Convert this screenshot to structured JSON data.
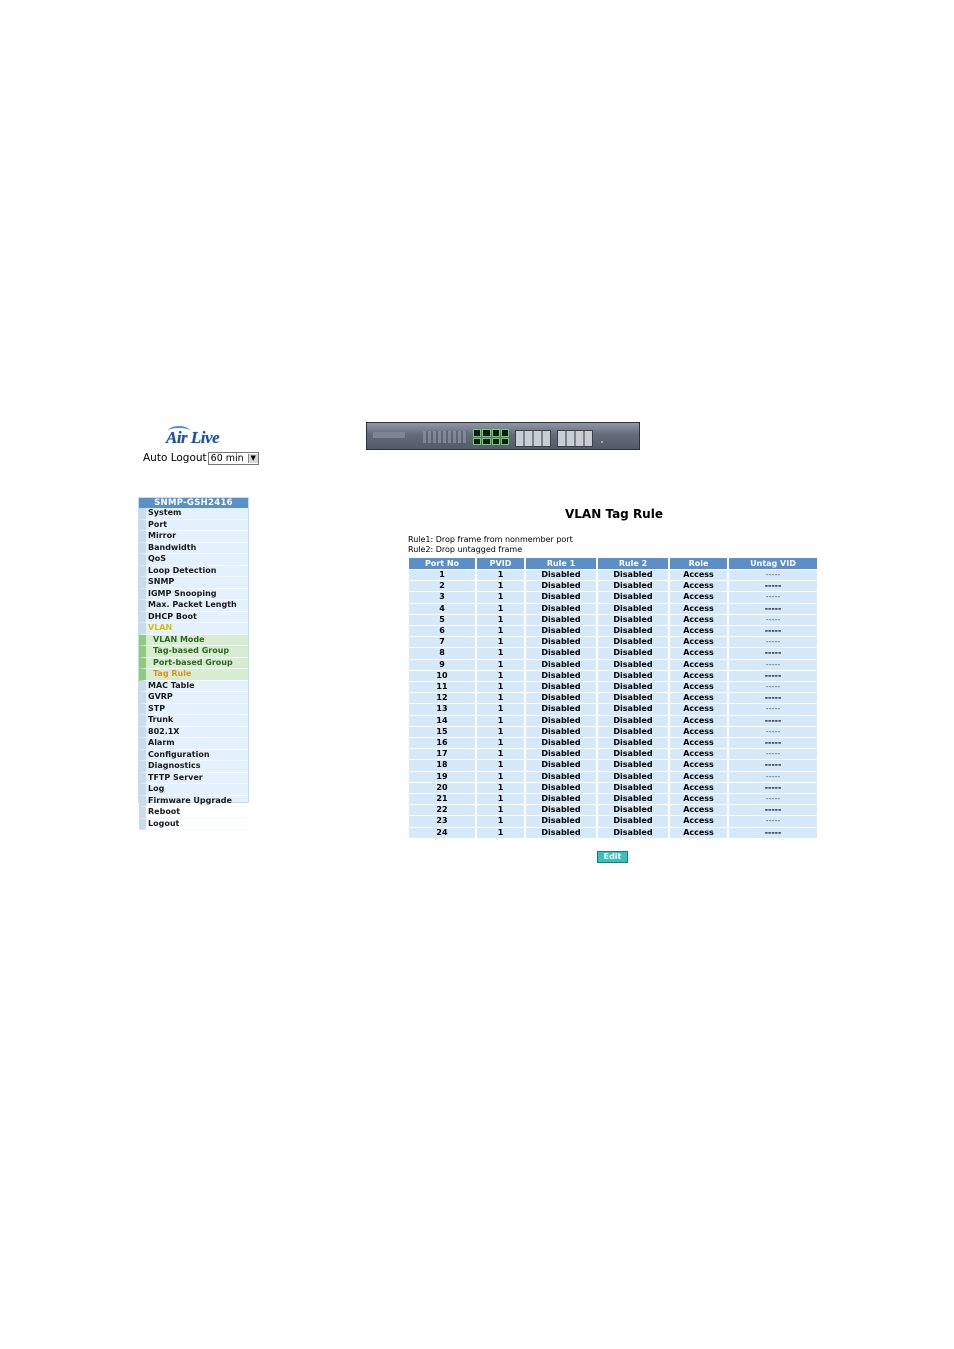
{
  "logo": {
    "text": "Air Live"
  },
  "auto_logout": {
    "label": "Auto Logout",
    "value": "60 min"
  },
  "menu": {
    "header": "SNMP-GSH2416",
    "items": [
      {
        "label": "System",
        "type": "item"
      },
      {
        "label": "Port",
        "type": "item"
      },
      {
        "label": "Mirror",
        "type": "item"
      },
      {
        "label": "Bandwidth",
        "type": "item"
      },
      {
        "label": "QoS",
        "type": "item"
      },
      {
        "label": "Loop Detection",
        "type": "item"
      },
      {
        "label": "SNMP",
        "type": "item"
      },
      {
        "label": "IGMP Snooping",
        "type": "item"
      },
      {
        "label": "Max. Packet Length",
        "type": "item"
      },
      {
        "label": "DHCP Boot",
        "type": "item"
      },
      {
        "label": "VLAN",
        "type": "vlan"
      },
      {
        "label": "VLAN Mode",
        "type": "sub"
      },
      {
        "label": "Tag-based Group",
        "type": "sub"
      },
      {
        "label": "Port-based Group",
        "type": "sub"
      },
      {
        "label": "Tag Rule",
        "type": "sub active"
      },
      {
        "label": "MAC Table",
        "type": "item"
      },
      {
        "label": "GVRP",
        "type": "item"
      },
      {
        "label": "STP",
        "type": "item"
      },
      {
        "label": "Trunk",
        "type": "item"
      },
      {
        "label": "802.1X",
        "type": "item"
      },
      {
        "label": "Alarm",
        "type": "item"
      },
      {
        "label": "Configuration",
        "type": "item"
      },
      {
        "label": "Diagnostics",
        "type": "item"
      },
      {
        "label": "TFTP Server",
        "type": "item"
      },
      {
        "label": "Log",
        "type": "item"
      },
      {
        "label": "Firmware Upgrade",
        "type": "item"
      },
      {
        "label": "Reboot",
        "type": "item"
      },
      {
        "label": "Logout",
        "type": "item"
      }
    ]
  },
  "page": {
    "title": "VLAN Tag Rule",
    "rule1": "Rule1: Drop frame from nonmember port",
    "rule2": "Rule2: Drop untagged frame"
  },
  "table": {
    "headers": [
      "Port No",
      "PVID",
      "Rule 1",
      "Rule 2",
      "Role",
      "Untag VID"
    ],
    "rows": [
      [
        "1",
        "1",
        "Disabled",
        "Disabled",
        "Access",
        "-----"
      ],
      [
        "2",
        "1",
        "Disabled",
        "Disabled",
        "Access",
        "-----"
      ],
      [
        "3",
        "1",
        "Disabled",
        "Disabled",
        "Access",
        "-----"
      ],
      [
        "4",
        "1",
        "Disabled",
        "Disabled",
        "Access",
        "-----"
      ],
      [
        "5",
        "1",
        "Disabled",
        "Disabled",
        "Access",
        "-----"
      ],
      [
        "6",
        "1",
        "Disabled",
        "Disabled",
        "Access",
        "-----"
      ],
      [
        "7",
        "1",
        "Disabled",
        "Disabled",
        "Access",
        "-----"
      ],
      [
        "8",
        "1",
        "Disabled",
        "Disabled",
        "Access",
        "-----"
      ],
      [
        "9",
        "1",
        "Disabled",
        "Disabled",
        "Access",
        "-----"
      ],
      [
        "10",
        "1",
        "Disabled",
        "Disabled",
        "Access",
        "-----"
      ],
      [
        "11",
        "1",
        "Disabled",
        "Disabled",
        "Access",
        "-----"
      ],
      [
        "12",
        "1",
        "Disabled",
        "Disabled",
        "Access",
        "-----"
      ],
      [
        "13",
        "1",
        "Disabled",
        "Disabled",
        "Access",
        "-----"
      ],
      [
        "14",
        "1",
        "Disabled",
        "Disabled",
        "Access",
        "-----"
      ],
      [
        "15",
        "1",
        "Disabled",
        "Disabled",
        "Access",
        "-----"
      ],
      [
        "16",
        "1",
        "Disabled",
        "Disabled",
        "Access",
        "-----"
      ],
      [
        "17",
        "1",
        "Disabled",
        "Disabled",
        "Access",
        "-----"
      ],
      [
        "18",
        "1",
        "Disabled",
        "Disabled",
        "Access",
        "-----"
      ],
      [
        "19",
        "1",
        "Disabled",
        "Disabled",
        "Access",
        "-----"
      ],
      [
        "20",
        "1",
        "Disabled",
        "Disabled",
        "Access",
        "-----"
      ],
      [
        "21",
        "1",
        "Disabled",
        "Disabled",
        "Access",
        "-----"
      ],
      [
        "22",
        "1",
        "Disabled",
        "Disabled",
        "Access",
        "-----"
      ],
      [
        "23",
        "1",
        "Disabled",
        "Disabled",
        "Access",
        "-----"
      ],
      [
        "24",
        "1",
        "Disabled",
        "Disabled",
        "Access",
        "-----"
      ]
    ]
  },
  "edit_button": {
    "label": "Edit"
  },
  "colors": {
    "header_blue": "#5a8fc7",
    "cell_blue": "#d6e9f8",
    "vlan_yellow": "#d6c200",
    "active_orange": "#e0901a",
    "edit_teal": "#33c3b8"
  }
}
